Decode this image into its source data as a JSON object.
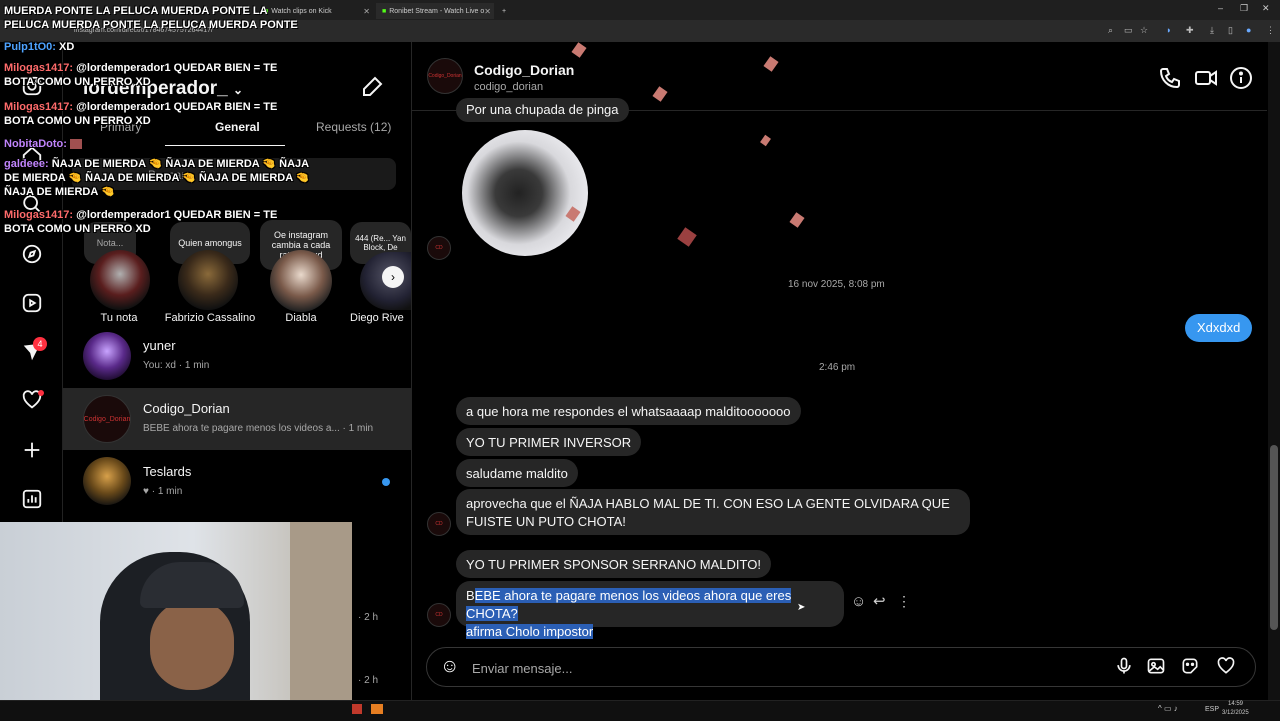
{
  "browser": {
    "tabs": [
      {
        "label": "Watch clips on Kick"
      },
      {
        "label": "Ronibet Stream - Watch Live o"
      }
    ],
    "url": "instagram.com/direct/t/17846745757264417/"
  },
  "stream_overlay": {
    "marquee": "MUERDA PONTE LA PELUCA MUERDA PONTE LA PELUCA MUERDA PONTE LA PELUCA MUERDA PONTE",
    "chat": [
      {
        "user": "Pulp1tO0:",
        "text": "XD",
        "color": "#4ea3ff"
      },
      {
        "user": "Milogas1417:",
        "text": "@lordemperador1 QUEDAR BIEN = TE BOTA COMO UN PERRO XD",
        "color": "#ff6b6b"
      },
      {
        "user": "Milogas1417:",
        "text": "@lordemperador1 QUEDAR BIEN = TE BOTA COMO UN PERRO XD",
        "color": "#ff6b6b"
      },
      {
        "user": "NobitaDoto:",
        "text": "",
        "color": "#c084fc"
      },
      {
        "user": "galdeee:",
        "text": "ÑAJA DE MIERDA 🤏 ÑAJA DE MIERDA 🤏 ÑAJA DE MIERDA 🤏 ÑAJA DE MIERDA 🤏 ÑAJA DE MIERDA 🤏 ÑAJA DE MIERDA 🤏",
        "color": "#c084fc"
      },
      {
        "user": "Milogas1417:",
        "text": "@lordemperador1 QUEDAR BIEN = TE BOTA COMO UN PERRO XD",
        "color": "#ff6b6b"
      }
    ]
  },
  "inbox": {
    "username": "lordemperador_",
    "tabs": {
      "primary": "Primary",
      "general": "General",
      "requests": "Requests (12)"
    },
    "search_placeholder": "Buscar",
    "notes": [
      {
        "bubble": "Nota...",
        "label": "Tu nota"
      },
      {
        "bubble": "Quien amongus",
        "label": "Fabrizio Cassalino"
      },
      {
        "bubble": "Oe instagram cambia a cada rato tmr xd",
        "label": "Diabla"
      },
      {
        "bubble": "444 (Re... Yan Block, De",
        "label": "Diego Rive"
      }
    ],
    "conversations": [
      {
        "name": "yuner",
        "preview": "You: xd · 1 min"
      },
      {
        "name": "Codigo_Dorian",
        "preview": "BEBE ahora te pagare menos los videos a... · 1 min"
      },
      {
        "name": "Teslards",
        "preview": "♥ · 1 min"
      },
      {
        "name": "",
        "preview": "· 2 h"
      },
      {
        "name": "",
        "preview": "· 2 h"
      }
    ],
    "unread_badge": "4"
  },
  "chat": {
    "name": "Codigo_Dorian",
    "handle": "codigo_dorian",
    "avatar_label": "Codigo_Dorian",
    "messages": {
      "top_partial": "Por una chupada de pinga",
      "ts1": "16 nov 2025, 8:08 pm",
      "mine1": "Xdxdxd",
      "ts2": "2:46 pm",
      "m1": "a que hora me respondes el whatsaaaap malditooooooo",
      "m2": "YO TU PRIMER INVERSOR",
      "m3": "saludame maldito",
      "m4a": "aprovecha que el ÑAJA HABLO MAL DE TI. CON ESO LA GENTE OLVIDARA QUE",
      "m4b": "FUISTE UN PUTO CHOTA!",
      "m5": "YO TU PRIMER SPONSOR SERRANO MALDITO!",
      "m6a_first": "B",
      "m6a_sel": "EBE ahora te pagare menos los videos ahora que eres CHOTA?",
      "m6b_sel": "afirma Cholo impostor"
    },
    "composer_placeholder": "Enviar mensaje..."
  },
  "taskbar": {
    "lang": "ESP",
    "time": "14:59",
    "date": "3/12/2025"
  },
  "colors": {
    "accent": "#3797f0",
    "bubble": "#262626",
    "selection": "#2b5fb5"
  }
}
